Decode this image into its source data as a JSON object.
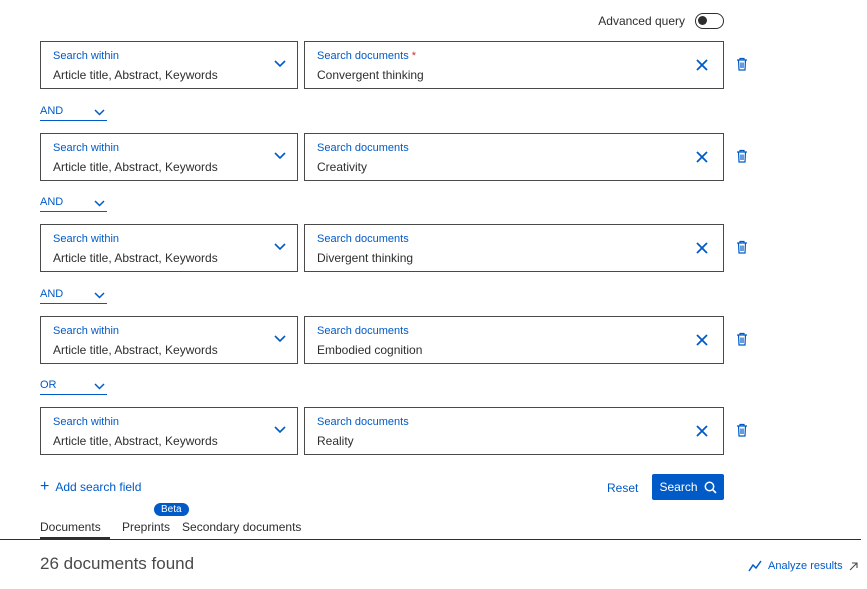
{
  "advanced_query": {
    "label": "Advanced query",
    "enabled": false
  },
  "rows": [
    {
      "within_label": "Search within",
      "within_value": "Article title, Abstract, Keywords",
      "docs_label": "Search documents",
      "required_marker": "*",
      "docs_value": "Convergent thinking"
    },
    {
      "within_label": "Search within",
      "within_value": "Article title, Abstract, Keywords",
      "docs_label": "Search documents",
      "docs_value": "Creativity"
    },
    {
      "within_label": "Search within",
      "within_value": "Article title, Abstract, Keywords",
      "docs_label": "Search documents",
      "docs_value": "Divergent thinking"
    },
    {
      "within_label": "Search within",
      "within_value": "Article title, Abstract, Keywords",
      "docs_label": "Search documents",
      "docs_value": "Embodied cognition"
    },
    {
      "within_label": "Search within",
      "within_value": "Article title, Abstract, Keywords",
      "docs_label": "Search documents",
      "docs_value": "Reality"
    }
  ],
  "operators": [
    "AND",
    "AND",
    "AND",
    "OR"
  ],
  "actions": {
    "add_field": "Add search field",
    "reset": "Reset",
    "search": "Search"
  },
  "tabs": [
    {
      "label": "Documents",
      "active": true
    },
    {
      "label": "Preprints",
      "badge": "Beta"
    },
    {
      "label": "Secondary documents"
    }
  ],
  "results": {
    "count_text": "26 documents found",
    "analyze": "Analyze results"
  },
  "colors": {
    "accent": "#005ac8",
    "text": "#2e2e2e",
    "required": "#c83232"
  }
}
